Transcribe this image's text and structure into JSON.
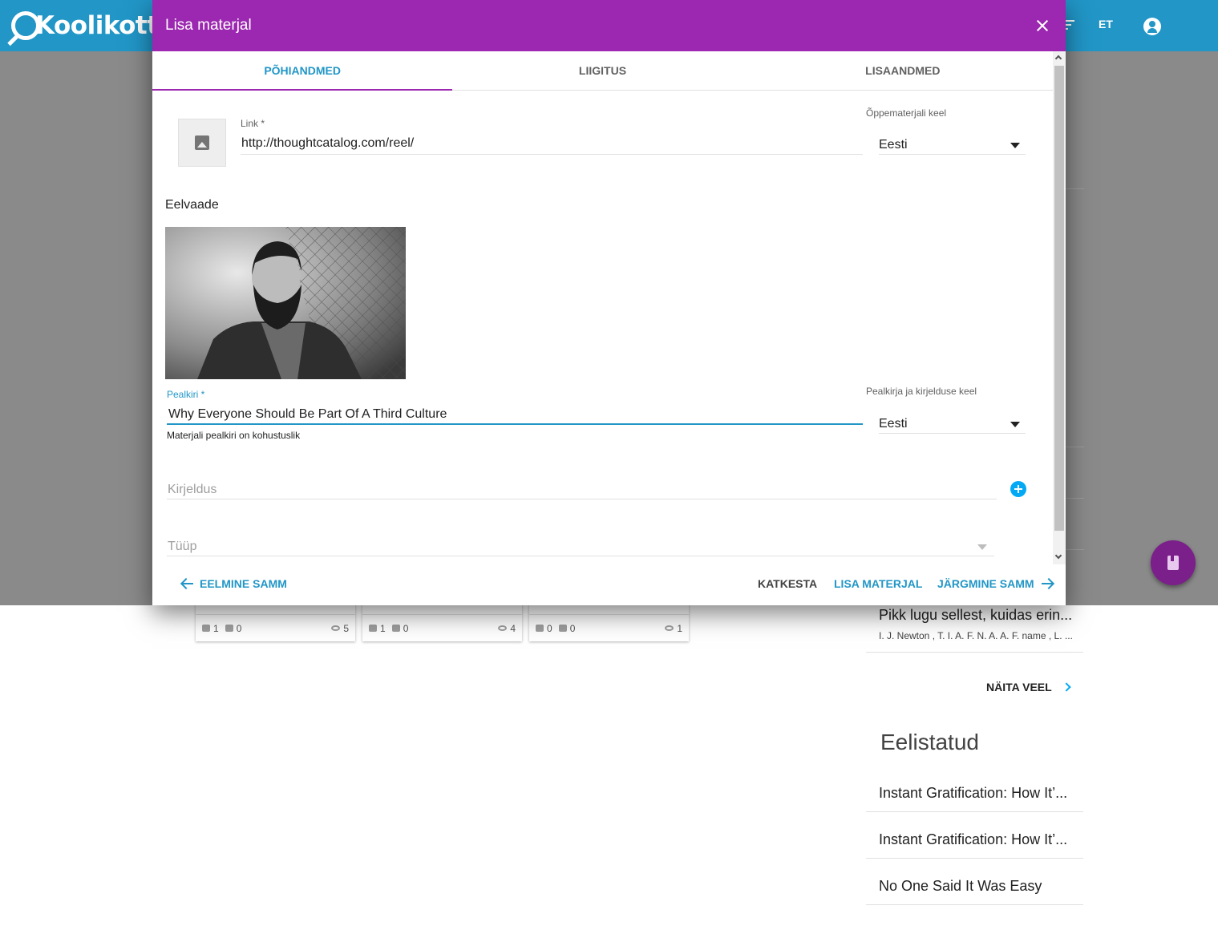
{
  "app": {
    "logo_text": "Koolikott",
    "language": "ET"
  },
  "dialog": {
    "title": "Lisa materjal",
    "tabs": [
      {
        "label": "PÕHIANDMED",
        "active": true
      },
      {
        "label": "LIIGITUS",
        "active": false
      },
      {
        "label": "LISAANDMED",
        "active": false
      }
    ],
    "link": {
      "label": "Link *",
      "value": "http://thoughtcatalog.com/reel/"
    },
    "material_language": {
      "label": "Õppematerjali keel",
      "value": "Eesti"
    },
    "preview_label": "Eelvaade",
    "title_field": {
      "label": "Pealkiri *",
      "value": "Why Everyone Should Be Part Of A Third Culture",
      "hint": "Materjali pealkiri on kohustuslik"
    },
    "title_language": {
      "label": "Pealkirja ja kirjelduse keel",
      "value": "Eesti"
    },
    "description": {
      "placeholder": "Kirjeldus"
    },
    "type": {
      "placeholder": "Tüüp"
    },
    "actions": {
      "previous": "EELMINE SAMM",
      "cancel": "KATKESTA",
      "add": "LISA MATERJAL",
      "next": "JÄRGMINE SAMM"
    },
    "colors": {
      "header": "#9c27b0",
      "accent": "#2196c7"
    }
  },
  "cards": [
    {
      "likes": "1",
      "dislikes": "0",
      "views": "5"
    },
    {
      "likes": "1",
      "dislikes": "0",
      "views": "4"
    },
    {
      "likes": "0",
      "dislikes": "0",
      "views": "1"
    }
  ],
  "sidebar": {
    "recent": {
      "title": "Pikk lugu sellest, kuidas erin...",
      "authors": "I. J. Newton , T. I. A. F. N. A. A. F. name , L. ..."
    },
    "more_label": "NÄITA VEEL",
    "favorites_heading": "Eelistatud",
    "favorites": [
      {
        "title": "Instant Gratification: How It’..."
      },
      {
        "title": "Instant Gratification: How It’..."
      },
      {
        "title": "No One Said It Was Easy"
      }
    ]
  }
}
